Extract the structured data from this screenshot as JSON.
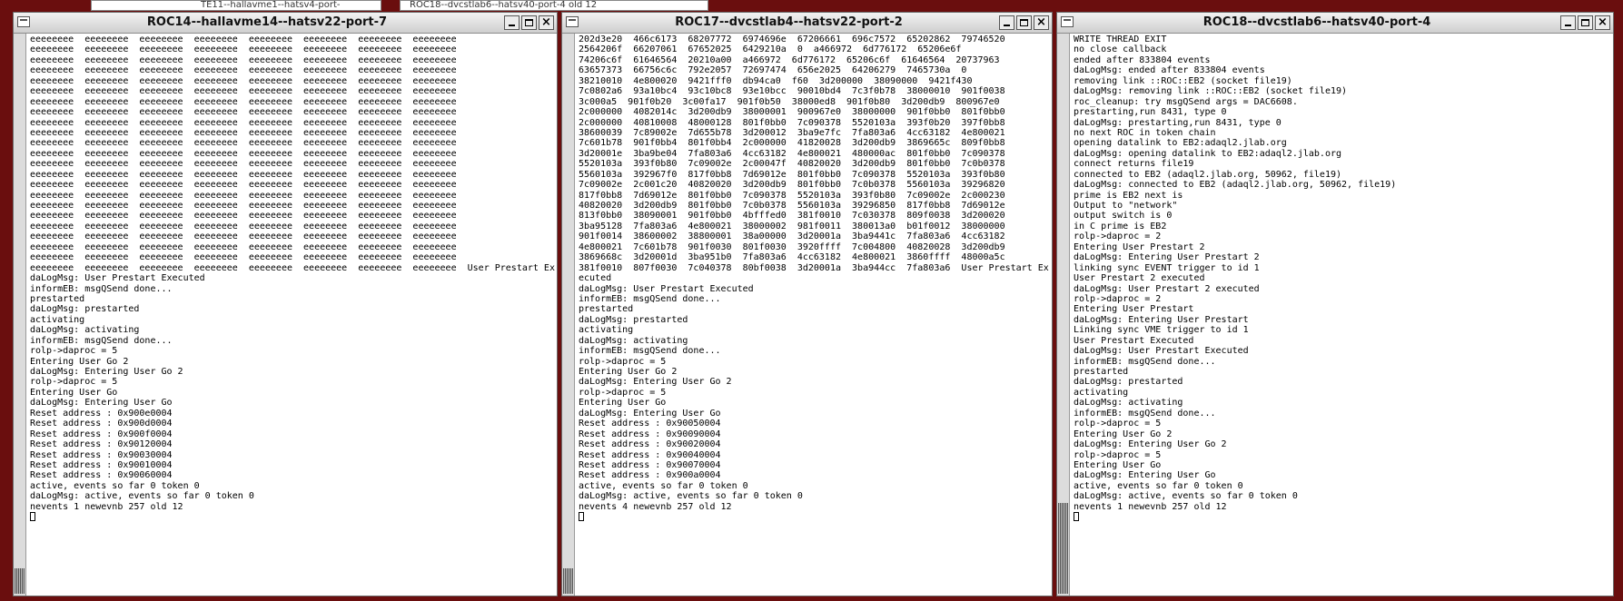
{
  "background_windows": [
    {
      "title": "TE11--hallavme1--hatsv4-port-"
    },
    {
      "title": "ROC18--dvcstlab6--hatsv40-port-4 old 12"
    }
  ],
  "windows": [
    {
      "title": "ROC14--hallavme14--hatsv22-port-7",
      "lines": [
        "eeeeeeee  eeeeeeee  eeeeeeee  eeeeeeee  eeeeeeee  eeeeeeee  eeeeeeee  eeeeeeee",
        "eeeeeeee  eeeeeeee  eeeeeeee  eeeeeeee  eeeeeeee  eeeeeeee  eeeeeeee  eeeeeeee",
        "eeeeeeee  eeeeeeee  eeeeeeee  eeeeeeee  eeeeeeee  eeeeeeee  eeeeeeee  eeeeeeee",
        "eeeeeeee  eeeeeeee  eeeeeeee  eeeeeeee  eeeeeeee  eeeeeeee  eeeeeeee  eeeeeeee",
        "eeeeeeee  eeeeeeee  eeeeeeee  eeeeeeee  eeeeeeee  eeeeeeee  eeeeeeee  eeeeeeee",
        "eeeeeeee  eeeeeeee  eeeeeeee  eeeeeeee  eeeeeeee  eeeeeeee  eeeeeeee  eeeeeeee",
        "eeeeeeee  eeeeeeee  eeeeeeee  eeeeeeee  eeeeeeee  eeeeeeee  eeeeeeee  eeeeeeee",
        "eeeeeeee  eeeeeeee  eeeeeeee  eeeeeeee  eeeeeeee  eeeeeeee  eeeeeeee  eeeeeeee",
        "eeeeeeee  eeeeeeee  eeeeeeee  eeeeeeee  eeeeeeee  eeeeeeee  eeeeeeee  eeeeeeee",
        "eeeeeeee  eeeeeeee  eeeeeeee  eeeeeeee  eeeeeeee  eeeeeeee  eeeeeeee  eeeeeeee",
        "eeeeeeee  eeeeeeee  eeeeeeee  eeeeeeee  eeeeeeee  eeeeeeee  eeeeeeee  eeeeeeee",
        "eeeeeeee  eeeeeeee  eeeeeeee  eeeeeeee  eeeeeeee  eeeeeeee  eeeeeeee  eeeeeeee",
        "eeeeeeee  eeeeeeee  eeeeeeee  eeeeeeee  eeeeeeee  eeeeeeee  eeeeeeee  eeeeeeee",
        "eeeeeeee  eeeeeeee  eeeeeeee  eeeeeeee  eeeeeeee  eeeeeeee  eeeeeeee  eeeeeeee",
        "eeeeeeee  eeeeeeee  eeeeeeee  eeeeeeee  eeeeeeee  eeeeeeee  eeeeeeee  eeeeeeee",
        "eeeeeeee  eeeeeeee  eeeeeeee  eeeeeeee  eeeeeeee  eeeeeeee  eeeeeeee  eeeeeeee",
        "eeeeeeee  eeeeeeee  eeeeeeee  eeeeeeee  eeeeeeee  eeeeeeee  eeeeeeee  eeeeeeee",
        "eeeeeeee  eeeeeeee  eeeeeeee  eeeeeeee  eeeeeeee  eeeeeeee  eeeeeeee  eeeeeeee",
        "eeeeeeee  eeeeeeee  eeeeeeee  eeeeeeee  eeeeeeee  eeeeeeee  eeeeeeee  eeeeeeee",
        "eeeeeeee  eeeeeeee  eeeeeeee  eeeeeeee  eeeeeeee  eeeeeeee  eeeeeeee  eeeeeeee",
        "eeeeeeee  eeeeeeee  eeeeeeee  eeeeeeee  eeeeeeee  eeeeeeee  eeeeeeee  eeeeeeee",
        "eeeeeeee  eeeeeeee  eeeeeeee  eeeeeeee  eeeeeeee  eeeeeeee  eeeeeeee  eeeeeeee",
        "eeeeeeee  eeeeeeee  eeeeeeee  eeeeeeee  eeeeeeee  eeeeeeee  eeeeeeee  eeeeeeee  User Prestart Executed",
        "daLogMsg: User Prestart Executed",
        "informEB: msgQSend done...",
        "prestarted",
        "daLogMsg: prestarted",
        "activating",
        "daLogMsg: activating",
        "informEB: msgQSend done...",
        "rolp->daproc = 5",
        "Entering User Go 2",
        "daLogMsg: Entering User Go 2",
        "rolp->daproc = 5",
        "Entering User Go",
        "daLogMsg: Entering User Go",
        "Reset address : 0x900e0004",
        "Reset address : 0x900d0004",
        "Reset address : 0x900f0004",
        "Reset address : 0x90120004",
        "Reset address : 0x90030004",
        "Reset address : 0x90010004",
        "Reset address : 0x90060004",
        "active, events so far 0 token 0",
        "daLogMsg: active, events so far 0 token 0",
        "nevents 1 newevnb 257 old 12"
      ]
    },
    {
      "title": "ROC17--dvcstlab4--hatsv22-port-2",
      "lines": [
        "202d3e20  466c6173  68207772  6974696e  67206661  696c7572  65202862  79746520",
        "2564206f  66207061  67652025  6429210a  0  a466972  6d776172  65206e6f",
        "74206c6f  61646564  20210a00  a466972  6d776172  65206c6f  61646564  20737963",
        "63657373  66756c6c  792e2057  72697474  656e2025  64206279  7465730a  0",
        "38210010  4e800020  9421fff0  db94ca0  f60  3d200000  38090000  9421f430",
        "7c0802a6  93a10bc4  93c10bc8  93e10bcc  90010bd4  7c3f0b78  38000010  901f0038",
        "3c000a5  901f0b20  3c00fa17  901f0b50  38000ed8  901f0b80  3d200db9  800967e0",
        "2c000000  4082014c  3d200db9  38000001  900967e0  38000000  901f0bb0  801f0bb0",
        "2c000000  40810008  48000128  801f0bb0  7c090378  5520103a  393f0b20  397f0bb8",
        "38600039  7c89002e  7d655b78  3d200012  3ba9e7fc  7fa803a6  4cc63182  4e800021",
        "7c601b78  901f0bb4  801f0bb4  2c000000  41820028  3d200db9  3869665c  809f0bb8",
        "3d20001e  3ba9be04  7fa803a6  4cc63182  4e800021  480000ac  801f0bb0  7c090378",
        "5520103a  393f0b80  7c09002e  2c00047f  40820020  3d200db9  801f0bb0  7c0b0378",
        "5560103a  392967f0  817f0bb8  7d69012e  801f0bb0  7c090378  5520103a  393f0b80",
        "7c09002e  2c001c20  40820020  3d200db9  801f0bb0  7c0b0378  5560103a  39296820",
        "817f0bb8  7d69012e  801f0bb0  7c090378  5520103a  393f0b80  7c09002e  2c000230",
        "40820020  3d200db9  801f0bb0  7c0b0378  5560103a  39296850  817f0bb8  7d69012e",
        "813f0bb0  38090001  901f0bb0  4bfffed0  381f0010  7c030378  809f0038  3d200020",
        "3ba95128  7fa803a6  4e800021  38000002  981f0011  380013a0  b01f0012  38000000",
        "901f0014  38600002  38800001  38a00000  3d20001a  3ba9441c  7fa803a6  4cc63182",
        "4e800021  7c601b78  901f0030  801f0030  3920ffff  7c004800  40820028  3d200db9",
        "3869668c  3d20001d  3ba951b0  7fa803a6  4cc63182  4e800021  3860ffff  48000a5c",
        "381f0010  807f0030  7c040378  80bf0038  3d20001a  3ba944cc  7fa803a6  User Prestart Ex",
        "ecuted",
        "daLogMsg: User Prestart Executed",
        "informEB: msgQSend done...",
        "prestarted",
        "daLogMsg: prestarted",
        "activating",
        "daLogMsg: activating",
        "informEB: msgQSend done...",
        "rolp->daproc = 5",
        "Entering User Go 2",
        "daLogMsg: Entering User Go 2",
        "rolp->daproc = 5",
        "Entering User Go",
        "daLogMsg: Entering User Go",
        "Reset address : 0x90050004",
        "Reset address : 0x90090004",
        "Reset address : 0x90020004",
        "Reset address : 0x90040004",
        "Reset address : 0x90070004",
        "Reset address : 0x900a0004",
        "active, events so far 0 token 0",
        "daLogMsg: active, events so far 0 token 0",
        "nevents 4 newevnb 257 old 12"
      ]
    },
    {
      "title": "ROC18--dvcstlab6--hatsv40-port-4",
      "lines": [
        "WRITE THREAD EXIT",
        "no close callback",
        "ended after 833804 events",
        "daLogMsg: ended after 833804 events",
        "removing link ::ROC::EB2 (socket file19)",
        "daLogMsg: removing link ::ROC::EB2 (socket file19)",
        "roc_cleanup: try msgQSend args = DAC6608.",
        "prestarting,run 8431, type 0",
        "daLogMsg: prestarting,run 8431, type 0",
        "no next ROC in token chain",
        "opening datalink to EB2:adaql2.jlab.org",
        "daLogMsg: opening datalink to EB2:adaql2.jlab.org",
        "connect returns file19",
        "connected to EB2 (adaql2.jlab.org, 50962, file19)",
        "daLogMsg: connected to EB2 (adaql2.jlab.org, 50962, file19)",
        "prime is EB2 next is",
        "Output to \"network\"",
        "output switch is 0",
        "in C prime is EB2",
        "rolp->daproc = 2",
        "Entering User Prestart 2",
        "daLogMsg: Entering User Prestart 2",
        "linking sync EVENT trigger to id 1",
        "User Prestart 2 executed",
        "daLogMsg: User Prestart 2 executed",
        "rolp->daproc = 2",
        "Entering User Prestart",
        "daLogMsg: Entering User Prestart",
        "Linking sync VME trigger to id 1",
        "User Prestart Executed",
        "daLogMsg: User Prestart Executed",
        "informEB: msgQSend done...",
        "prestarted",
        "daLogMsg: prestarted",
        "activating",
        "daLogMsg: activating",
        "informEB: msgQSend done...",
        "rolp->daproc = 5",
        "Entering User Go 2",
        "daLogMsg: Entering User Go 2",
        "rolp->daproc = 5",
        "Entering User Go",
        "daLogMsg: Entering User Go",
        "active, events so far 0 token 0",
        "daLogMsg: active, events so far 0 token 0",
        "nevents 1 newevnb 257 old 12"
      ]
    }
  ]
}
